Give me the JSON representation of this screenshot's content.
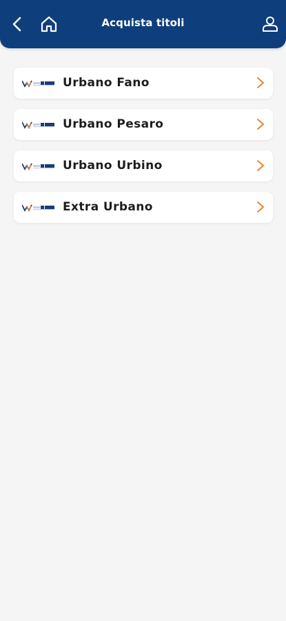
{
  "header": {
    "title": "Acquista titoli",
    "back_icon": "chevron-left-icon",
    "home_icon": "home-icon",
    "user_icon": "user-icon",
    "background": "#0f3e7c"
  },
  "list": {
    "items": [
      {
        "label": "Urbano Fano",
        "logo": "adriabus-logo",
        "chevron": "chevron-right-icon"
      },
      {
        "label": "Urbano Pesaro",
        "logo": "adriabus-logo",
        "chevron": "chevron-right-icon"
      },
      {
        "label": "Urbano Urbino",
        "logo": "adriabus-logo",
        "chevron": "chevron-right-icon"
      },
      {
        "label": "Extra Urbano",
        "logo": "adriabus-logo",
        "chevron": "chevron-right-icon"
      }
    ],
    "chevron_color": "#e8862e"
  }
}
